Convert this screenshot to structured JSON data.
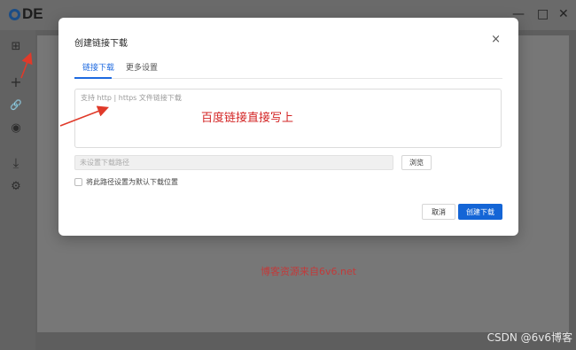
{
  "app": {
    "logo_text": "DE",
    "window_buttons": {
      "minimize": "—",
      "maximize": "□",
      "close": "✕"
    }
  },
  "sidebar": {
    "items": [
      {
        "icon": "grid-icon",
        "glyph": "⊞"
      },
      {
        "icon": "plus-icon",
        "glyph": "+"
      },
      {
        "icon": "link-icon",
        "glyph": "🔗"
      },
      {
        "icon": "user-icon",
        "glyph": "◉"
      },
      {
        "icon": "download-icon",
        "glyph": "⤓"
      },
      {
        "icon": "settings-icon",
        "glyph": "⚙"
      }
    ]
  },
  "dialog": {
    "title": "创建链接下载",
    "close_glyph": "×",
    "tabs": [
      {
        "label": "链接下载",
        "active": true
      },
      {
        "label": "更多设置",
        "active": false
      }
    ],
    "url_placeholder": "支持 http | https 文件链接下载",
    "path_placeholder": "未设置下载路径",
    "browse_label": "浏览",
    "default_path_label": "将此路径设置为默认下载位置",
    "cancel_label": "取消",
    "confirm_label": "创建下载"
  },
  "annotations": {
    "url_hint": "百度链接直接写上",
    "watermark": "博客资源来自6v6.net",
    "credit": "CSDN @6v6博客"
  },
  "colors": {
    "accent": "#1465d6",
    "annotation_red": "#d32424"
  }
}
